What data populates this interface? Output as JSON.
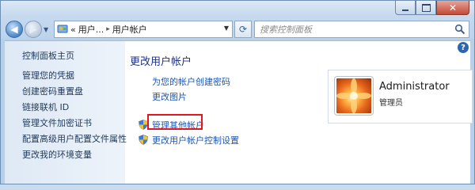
{
  "window": {
    "minimize_icon": "minimize-icon",
    "maximize_icon": "maximize-icon",
    "close_icon": "close-icon"
  },
  "address_bar": {
    "breadcrumb_prefix": "«",
    "crumb1": "用户...",
    "separator": "▸",
    "crumb2": "用户帐户"
  },
  "search": {
    "placeholder": "搜索控制面板"
  },
  "sidebar": {
    "home": "控制面板主页",
    "items": [
      "管理您的凭据",
      "创建密码重置盘",
      "链接联机 ID",
      "管理文件加密证书",
      "配置高级用户配置文件属性",
      "更改我的环境变量"
    ]
  },
  "main": {
    "title": "更改用户帐户",
    "links": {
      "create_password": "为您的帐户创建密码",
      "change_picture": "更改图片",
      "manage_other": "管理其他帐户",
      "uac_settings": "更改用户帐户控制设置"
    },
    "help_label": "?"
  },
  "user": {
    "name": "Administrator",
    "role": "管理员"
  },
  "colors": {
    "link": "#1a55b6",
    "title": "#1e3287",
    "highlight_box": "#e2161b"
  }
}
